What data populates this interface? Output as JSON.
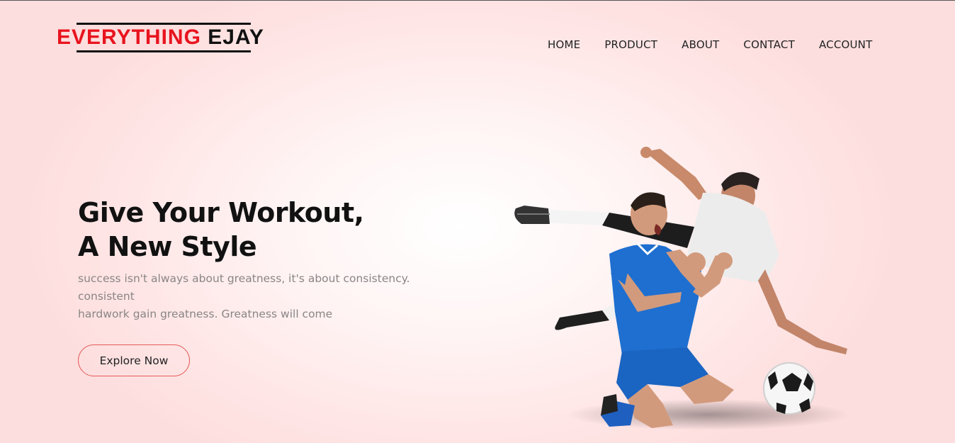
{
  "brand": {
    "part1": "EVERYTHING",
    "part2": "EJAY"
  },
  "nav": [
    "HOME",
    "PRODUCT",
    "ABOUT",
    "CONTACT",
    "ACCOUNT"
  ],
  "hero": {
    "title_line1": "Give Your Workout,",
    "title_line2": "A New Style",
    "sub_line1": "success isn't always about greatness, it's about consistency.",
    "sub_line2": "consistent",
    "sub_line3": "hardwork gain greatness. Greatness will come",
    "cta_label": "Explore Now"
  },
  "colors": {
    "brand_red": "#e8141e",
    "cta_border": "#e45b5b",
    "jersey_blue": "#1e6fd0"
  }
}
